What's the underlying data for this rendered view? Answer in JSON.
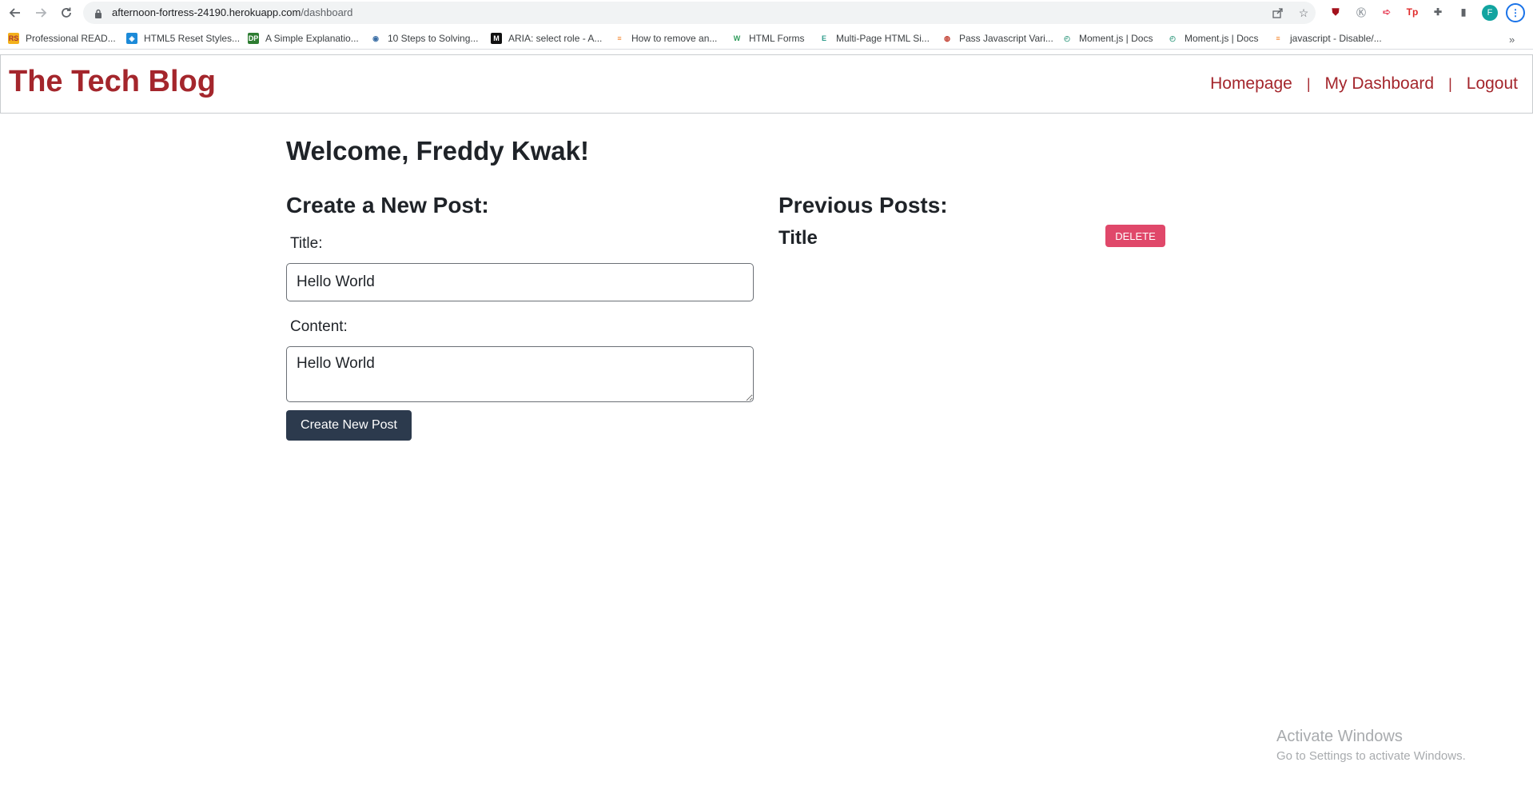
{
  "browser": {
    "url_host": "afternoon-fortress-24190.herokuapp.com",
    "url_path": "/dashboard",
    "profile_initial": "F",
    "extensions": [
      {
        "name": "ublock-icon",
        "glyph": "⛊",
        "color": "#a3111c"
      },
      {
        "name": "extension-grey-icon",
        "glyph": "Ⓚ",
        "color": "#9aa0a6"
      },
      {
        "name": "extension-arrow-icon",
        "glyph": "➪",
        "color": "#e8455c"
      },
      {
        "name": "extension-tp-icon",
        "glyph": "Tp",
        "color": "#e02b2b"
      },
      {
        "name": "puzzle-icon",
        "glyph": "✚",
        "color": "#5f6368"
      },
      {
        "name": "sidepanel-icon",
        "glyph": "▮",
        "color": "#5f6368"
      }
    ]
  },
  "bookmarks": [
    {
      "label": "Professional READ...",
      "icon": "readme-icon",
      "glyph": "RS",
      "bg": "#f3b11b",
      "fg": "#a33"
    },
    {
      "label": "HTML5 Reset Styles...",
      "icon": "html5-reset-icon",
      "glyph": "◈",
      "bg": "#1c8ad8",
      "fg": "#fff"
    },
    {
      "label": "A Simple Explanatio...",
      "icon": "dp-icon",
      "glyph": "DP",
      "bg": "#2e7d32",
      "fg": "#fff"
    },
    {
      "label": "10 Steps to Solving...",
      "icon": "eye-icon",
      "glyph": "◉",
      "bg": "#ffffff",
      "fg": "#3a6ea5"
    },
    {
      "label": "ARIA: select role - A...",
      "icon": "mdn-icon",
      "glyph": "M",
      "bg": "#111111",
      "fg": "#fff"
    },
    {
      "label": "How to remove an...",
      "icon": "stackoverflow-icon",
      "glyph": "≡",
      "bg": "#ffffff",
      "fg": "#f48024"
    },
    {
      "label": "HTML Forms",
      "icon": "w3schools-icon",
      "glyph": "W",
      "bg": "#ffffff",
      "fg": "#2e9c5b"
    },
    {
      "label": "Multi-Page HTML Si...",
      "icon": "e-icon",
      "glyph": "E",
      "bg": "#ffffff",
      "fg": "#2e9c8b"
    },
    {
      "label": "Pass Javascript Vari...",
      "icon": "globe-icon",
      "glyph": "◍",
      "bg": "#ffffff",
      "fg": "#c0392b"
    },
    {
      "label": "Moment.js | Docs",
      "icon": "clock-icon",
      "glyph": "◴",
      "bg": "#ffffff",
      "fg": "#4aa58d"
    },
    {
      "label": "Moment.js | Docs",
      "icon": "clock-icon",
      "glyph": "◴",
      "bg": "#ffffff",
      "fg": "#4aa58d"
    },
    {
      "label": "javascript - Disable/...",
      "icon": "stackoverflow-icon",
      "glyph": "≡",
      "bg": "#ffffff",
      "fg": "#f48024"
    }
  ],
  "header": {
    "site_title": "The Tech Blog",
    "nav": [
      "Homepage",
      "My Dashboard",
      "Logout"
    ],
    "separator": "|"
  },
  "dashboard": {
    "welcome": "Welcome, Freddy Kwak!",
    "new_post": {
      "heading": "Create a New Post:",
      "title_label": "Title:",
      "title_value": "Hello World",
      "content_label": "Content:",
      "content_value": "Hello World",
      "submit_label": "Create New Post"
    },
    "previous_posts": {
      "heading": "Previous Posts:",
      "posts": [
        {
          "title": "Title",
          "delete_label": "DELETE"
        }
      ]
    }
  },
  "watermark": {
    "title": "Activate Windows",
    "subtitle": "Go to Settings to activate Windows."
  }
}
